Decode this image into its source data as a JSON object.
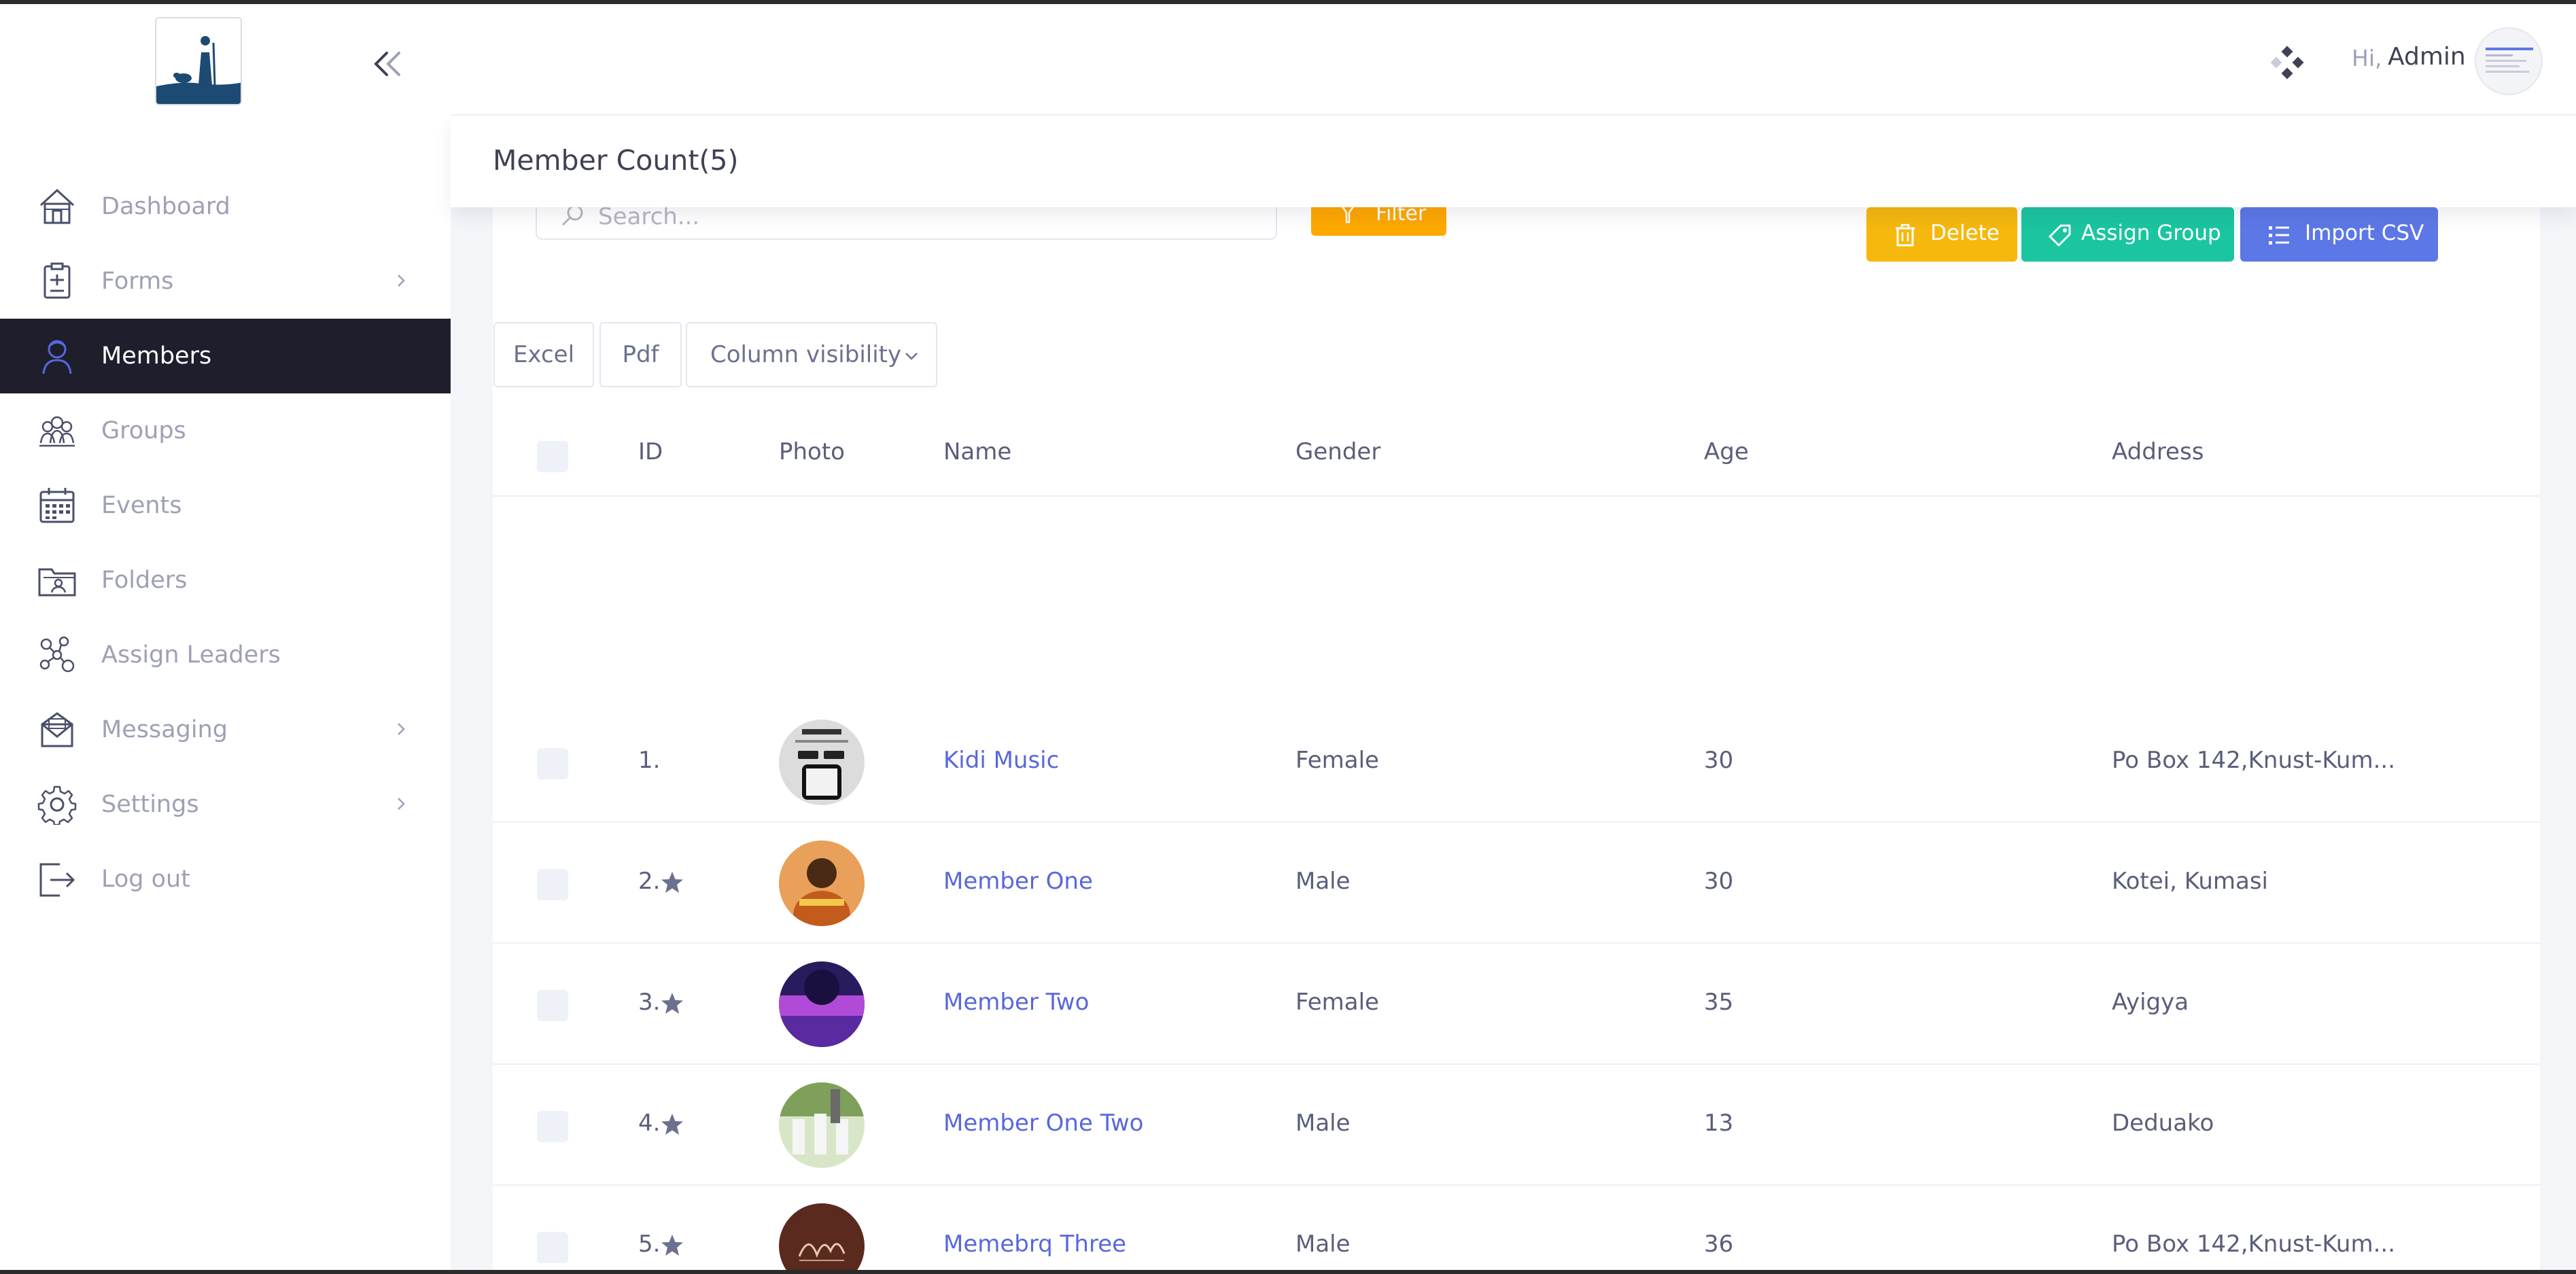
{
  "sidebar": {
    "items": [
      {
        "label": "Dashboard",
        "icon": "home-icon",
        "active": false,
        "has_submenu": false
      },
      {
        "label": "Forms",
        "icon": "clipboard-icon",
        "active": false,
        "has_submenu": true
      },
      {
        "label": "Members",
        "icon": "user-icon",
        "active": true,
        "has_submenu": false
      },
      {
        "label": "Groups",
        "icon": "group-icon",
        "active": false,
        "has_submenu": false
      },
      {
        "label": "Events",
        "icon": "calendar-icon",
        "active": false,
        "has_submenu": false
      },
      {
        "label": "Folders",
        "icon": "folder-icon",
        "active": false,
        "has_submenu": false
      },
      {
        "label": "Assign Leaders",
        "icon": "network-icon",
        "active": false,
        "has_submenu": false
      },
      {
        "label": "Messaging",
        "icon": "envelope-icon",
        "active": false,
        "has_submenu": true
      },
      {
        "label": "Settings",
        "icon": "gear-icon",
        "active": false,
        "has_submenu": true
      },
      {
        "label": "Log out",
        "icon": "logout-icon",
        "active": false,
        "has_submenu": false
      }
    ]
  },
  "header": {
    "greeting": "Hi,",
    "user_name": "Admin"
  },
  "page": {
    "title": "Member Count(5)"
  },
  "toolbar": {
    "search_placeholder": "Search...",
    "filter_label": "Filter",
    "delete_label": "Delete",
    "assign_group_label": "Assign Group",
    "import_csv_label": "Import CSV"
  },
  "export": {
    "excel_label": "Excel",
    "pdf_label": "Pdf",
    "column_visibility_label": "Column visibility"
  },
  "table": {
    "headers": {
      "id": "ID",
      "photo": "Photo",
      "name": "Name",
      "gender": "Gender",
      "age": "Age",
      "address": "Address"
    },
    "rows": [
      {
        "id": "1.",
        "starred": false,
        "name": "Kidi Music",
        "gender": "Female",
        "age": "30",
        "address": "Po Box 142,Knust-Kum..."
      },
      {
        "id": "2.",
        "starred": true,
        "name": "Member One",
        "gender": "Male",
        "age": "30",
        "address": "Kotei, Kumasi"
      },
      {
        "id": "3.",
        "starred": true,
        "name": "Member Two",
        "gender": "Female",
        "age": "35",
        "address": "Ayigya"
      },
      {
        "id": "4.",
        "starred": true,
        "name": "Member One Two",
        "gender": "Male",
        "age": "13",
        "address": "Deduako"
      },
      {
        "id": "5.",
        "starred": true,
        "name": "Memebrq Three",
        "gender": "Male",
        "age": "36",
        "address": "Po Box 142,Knust-Kum..."
      }
    ]
  },
  "colors": {
    "sidebar_active_bg": "#1e1e2d",
    "link": "#5867dd",
    "delete": "#f6b80d",
    "assign_group": "#1bc5a0",
    "import_csv": "#5c78e6",
    "filter": "#ffa800"
  }
}
